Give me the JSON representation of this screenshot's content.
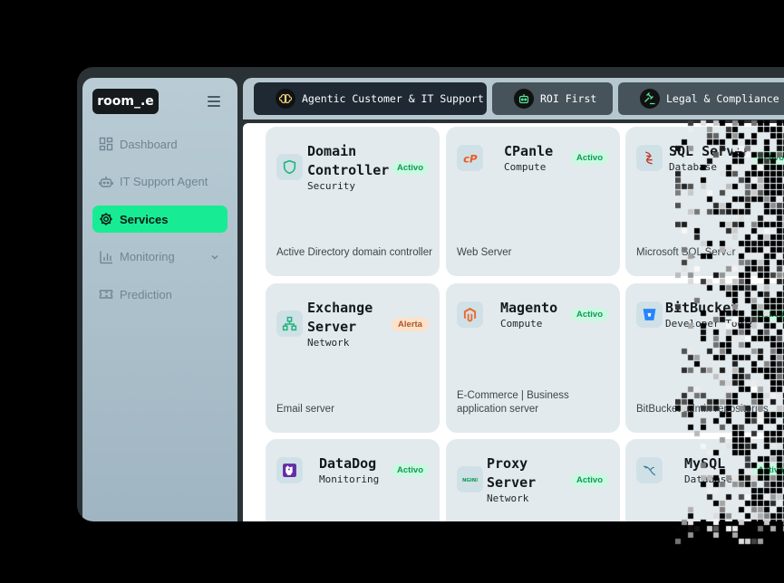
{
  "logo": "room_.e",
  "sidebar": {
    "items": [
      {
        "label": "Dashboard"
      },
      {
        "label": "IT Support Agent"
      },
      {
        "label": "Services"
      },
      {
        "label": "Monitoring"
      },
      {
        "label": "Prediction"
      }
    ]
  },
  "tabs": [
    {
      "label": "Agentic Customer & IT Support"
    },
    {
      "label": "ROI First"
    },
    {
      "label": "Legal & Compliance"
    }
  ],
  "services": [
    {
      "title": "Domain Controller",
      "category": "Security",
      "status": "Activo",
      "description": "Active Directory domain controller",
      "icon": "shield-icon"
    },
    {
      "title": "CPanle",
      "category": "Compute",
      "status": "Activo",
      "description": "Web Server",
      "icon": "cpanel-icon"
    },
    {
      "title": "SQL Server",
      "category": "Database",
      "status": "Activo",
      "description": "Microsoft SQL Server",
      "icon": "sql-server-icon"
    },
    {
      "title": "Exchange Server",
      "category": "Network",
      "status": "Alerta",
      "description": "Email server",
      "icon": "network-icon"
    },
    {
      "title": "Magento",
      "category": "Compute",
      "status": "Activo",
      "description": "E-Commerce | Business application server",
      "icon": "magento-icon"
    },
    {
      "title": "BitBucket",
      "category": "Developer Tools",
      "status": "Activo",
      "description": "BitBucket admin repositories",
      "icon": "bitbucket-icon"
    },
    {
      "title": "DataDog",
      "category": "Monitoring",
      "status": "Activo",
      "description": "",
      "icon": "datadog-icon"
    },
    {
      "title": "Proxy Server",
      "category": "Network",
      "status": "Activo",
      "description": "",
      "icon": "nginx-icon"
    },
    {
      "title": "MySQL",
      "category": "Database",
      "status": "Activo",
      "description": "",
      "icon": "mysql-icon"
    }
  ],
  "colors": {
    "accent": "#17ec95",
    "active_badge_bg": "#cbf8e1",
    "alert_badge_bg": "#fde1c9"
  }
}
